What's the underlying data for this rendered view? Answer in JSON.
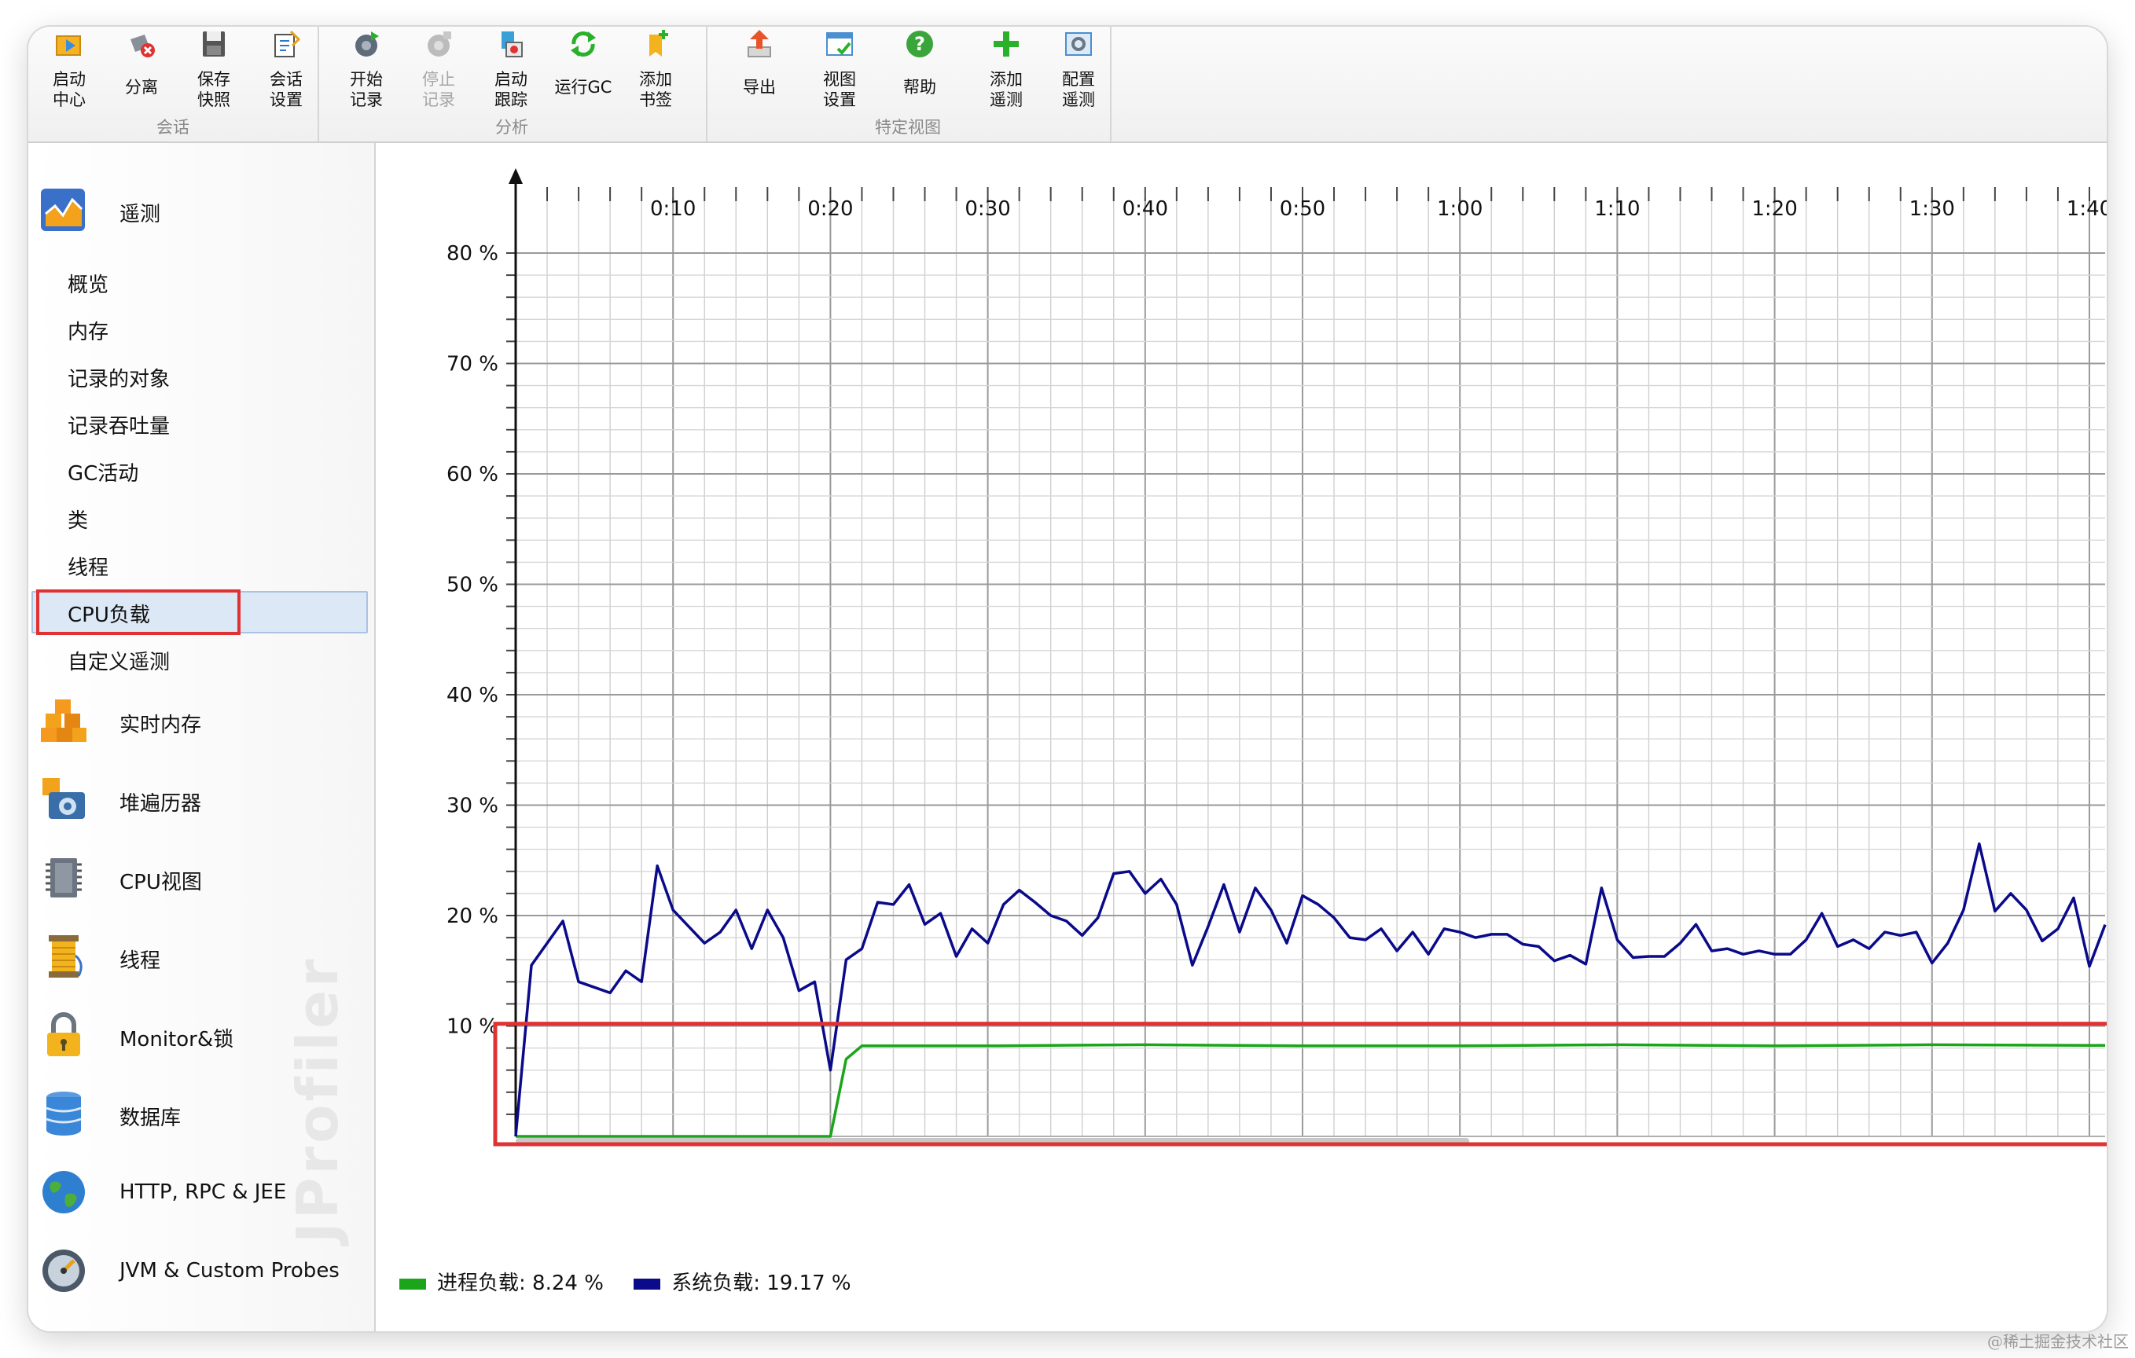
{
  "toolbar": {
    "groups": [
      {
        "title": "会话",
        "buttons": [
          {
            "label": "启动\n中心",
            "icon": "start-center-icon"
          },
          {
            "label": "分离",
            "icon": "detach-icon"
          },
          {
            "label": "保存\n快照",
            "icon": "save-snapshot-icon"
          },
          {
            "label": "会话\n设置",
            "icon": "session-settings-icon"
          }
        ]
      },
      {
        "title": "分析",
        "buttons": [
          {
            "label": "开始\n记录",
            "icon": "start-recording-icon"
          },
          {
            "label": "停止\n记录",
            "icon": "stop-recording-icon",
            "disabled": true
          },
          {
            "label": "启动\n跟踪",
            "icon": "start-tracking-icon"
          },
          {
            "label": "运行GC",
            "icon": "run-gc-icon"
          },
          {
            "label": "添加\n书签",
            "icon": "add-bookmark-icon"
          }
        ]
      },
      {
        "title": "特定视图",
        "buttons": [
          {
            "label": "导出",
            "icon": "export-icon"
          },
          {
            "label": "视图\n设置",
            "icon": "view-settings-icon"
          },
          {
            "label": "帮助",
            "icon": "help-icon"
          },
          {
            "label": "添加\n遥测",
            "icon": "add-telemetry-icon"
          },
          {
            "label": "配置\n遥测",
            "icon": "configure-telemetry-icon"
          }
        ]
      }
    ]
  },
  "sidebar": {
    "telemetry": {
      "label": "遥测",
      "items": [
        "概览",
        "内存",
        "记录的对象",
        "记录吞吐量",
        "GC活动",
        "类",
        "线程",
        "CPU负载",
        "自定义遥测"
      ],
      "selected": "CPU负载"
    },
    "sections": [
      {
        "label": "实时内存",
        "icon": "live-memory-icon"
      },
      {
        "label": "堆遍历器",
        "icon": "heap-walker-icon"
      },
      {
        "label": "CPU视图",
        "icon": "cpu-views-icon"
      },
      {
        "label": "线程",
        "icon": "threads-icon"
      },
      {
        "label": "Monitor&锁",
        "icon": "monitor-lock-icon"
      },
      {
        "label": "数据库",
        "icon": "database-icon"
      },
      {
        "label": "HTTP, RPC & JEE",
        "icon": "http-globe-icon"
      },
      {
        "label": "JVM & Custom Probes",
        "icon": "jvm-probe-icon"
      }
    ],
    "watermark": "JProfiler"
  },
  "chart_data": {
    "type": "line",
    "x_unit": "seconds",
    "x_tick_labels": [
      "0:10",
      "0:20",
      "0:30",
      "0:40",
      "0:50",
      "1:00",
      "1:10",
      "1:20",
      "1:30",
      "1:40"
    ],
    "y_tick_labels": [
      "10 %",
      "20 %",
      "30 %",
      "40 %",
      "50 %",
      "60 %",
      "70 %",
      "80 %"
    ],
    "xlim": [
      0,
      101
    ],
    "ylim": [
      0,
      80
    ],
    "grid": true,
    "legend_position": "bottom-left",
    "series": [
      {
        "name": "进程负载",
        "current": "8.24 %",
        "color": "#1aa51a",
        "x": [
          0,
          20,
          21,
          22,
          30,
          40,
          50,
          60,
          70,
          80,
          90,
          101
        ],
        "y": [
          0,
          0,
          7,
          8.2,
          8.2,
          8.3,
          8.2,
          8.2,
          8.3,
          8.2,
          8.3,
          8.24
        ]
      },
      {
        "name": "系统负载",
        "current": "19.17 %",
        "color": "#0a0a8a",
        "x": [
          0,
          1,
          2,
          3,
          4,
          5,
          6,
          7,
          8,
          9,
          10,
          11,
          12,
          13,
          14,
          15,
          16,
          17,
          18,
          19,
          20,
          21,
          22,
          23,
          24,
          25,
          26,
          27,
          28,
          29,
          30,
          31,
          32,
          33,
          34,
          35,
          36,
          37,
          38,
          39,
          40,
          41,
          42,
          43,
          44,
          45,
          46,
          47,
          48,
          49,
          50,
          51,
          52,
          53,
          54,
          55,
          56,
          57,
          58,
          59,
          60,
          61,
          62,
          63,
          64,
          65,
          66,
          67,
          68,
          69,
          70,
          71,
          72,
          73,
          74,
          75,
          76,
          77,
          78,
          79,
          80,
          81,
          82,
          83,
          84,
          85,
          86,
          87,
          88,
          89,
          90,
          91,
          92,
          93,
          94,
          95,
          96,
          97,
          98,
          99,
          100,
          101
        ],
        "y": [
          0,
          15.5,
          17.5,
          19.5,
          14,
          13.5,
          13,
          15,
          14,
          24.5,
          20.5,
          19,
          17.5,
          18.5,
          20.5,
          17,
          20.5,
          18,
          13.2,
          14,
          6,
          16,
          17,
          21.2,
          21,
          22.8,
          19.2,
          20.2,
          16.3,
          18.8,
          17.5,
          21,
          22.3,
          21.2,
          20,
          19.5,
          18.2,
          19.8,
          23.8,
          24,
          22,
          23.3,
          21,
          15.5,
          19,
          22.8,
          18.5,
          22.5,
          20.5,
          17.5,
          21.8,
          21,
          19.8,
          18,
          17.8,
          18.8,
          16.8,
          18.5,
          16.5,
          18.8,
          18.5,
          18,
          18.3,
          18.3,
          17.4,
          17.2,
          15.9,
          16.4,
          15.6,
          22.5,
          17.8,
          16.2,
          16.3,
          16.3,
          17.5,
          19.2,
          16.8,
          17,
          16.5,
          16.8,
          16.5,
          16.5,
          17.8,
          20.2,
          17.2,
          17.8,
          17,
          18.5,
          18.2,
          18.5,
          15.7,
          17.5,
          20.5,
          26.5,
          20.4,
          22,
          20.5,
          17.7,
          18.8,
          21.6,
          15.4,
          19.17
        ]
      }
    ]
  },
  "footer": {
    "credit": "@稀土掘金技术社区"
  },
  "colors": {
    "highlight": "#e03232",
    "selection": "#dde8f6"
  }
}
